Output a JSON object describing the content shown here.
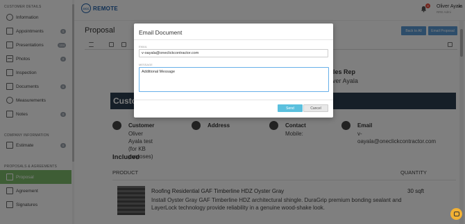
{
  "sidebar": {
    "sections": {
      "customer": "CUSTOMER DETAILS",
      "company": "COMPANY INFORMATION",
      "proposals": "PROPOSALS & AGREEMENTS"
    },
    "items": [
      {
        "label": "Information",
        "count": "",
        "icon": "info-icon"
      },
      {
        "label": "Appointments",
        "count": "0",
        "icon": "calendar-icon"
      },
      {
        "label": "Presentations",
        "count": "104",
        "icon": "presentation-icon"
      },
      {
        "label": "Photos",
        "count": "0",
        "icon": "image-icon"
      },
      {
        "label": "Inspection",
        "count": "",
        "icon": "document-icon"
      },
      {
        "label": "Documents",
        "count": "0",
        "icon": "folder-icon"
      },
      {
        "label": "Measurements",
        "count": "",
        "icon": "ruler-icon"
      },
      {
        "label": "Notes",
        "count": "0",
        "icon": "pencil-icon"
      },
      {
        "label": "Estimate",
        "count": "0",
        "icon": "calculator-icon"
      },
      {
        "label": "Proposal",
        "count": "",
        "icon": "document-icon",
        "active": true
      },
      {
        "label": "Agreement",
        "count": "",
        "icon": "document-icon"
      },
      {
        "label": "Signatures",
        "count": "",
        "icon": "signature-icon"
      }
    ]
  },
  "topbar": {
    "logo_text": "REMOTE",
    "logo_mark": "OCC",
    "logo_sub": "",
    "notification_count": "4",
    "user_name": "Oliver Ayala",
    "user_role": "RRE Admi"
  },
  "main": {
    "page_title": "Proposal",
    "back_button": "Back to All",
    "email_button": "Email Proposal"
  },
  "document": {
    "sales_rep_label": "ales Rep",
    "sales_rep_name": "liver Ayala",
    "customer_band": "Custo",
    "customer_title": "Customer",
    "customer_value": "Oliver Ayala test (for KB\npurposes)",
    "address_title": "Address",
    "contact_title": "Contact",
    "contact_value": "Mobile:",
    "email_title": "Email",
    "email_value": "v-\noayala@oneclickcontractor.com",
    "included_heading": "Included",
    "product_col": "PRODUCT",
    "quantity_col": "QUANTITY",
    "product_title": "Roofing Residential GAF Timberline HDZ Oyster Gray",
    "product_desc": "Install Oyster Gray GAF Timberline HDZ architectural shingle. DuraGrip premium bonding sealant and LayerLock technology provide reliability in a genuine wood-shake look.",
    "product_qty": "30 sqft"
  },
  "modal": {
    "title": "Email Document",
    "email_label": "EMAIL",
    "email_value": "v-oayala@oneclickcontractor.com",
    "message_label": "MESSAGE",
    "message_value": "Additional Message",
    "send_button": "Send",
    "cancel_button": "Cancel"
  },
  "colors": {
    "accent": "#5b9bd5",
    "active_nav": "#7cbb6a",
    "send": "#5bc0de",
    "band": "#2c3e50",
    "chat": "#f2b134"
  }
}
